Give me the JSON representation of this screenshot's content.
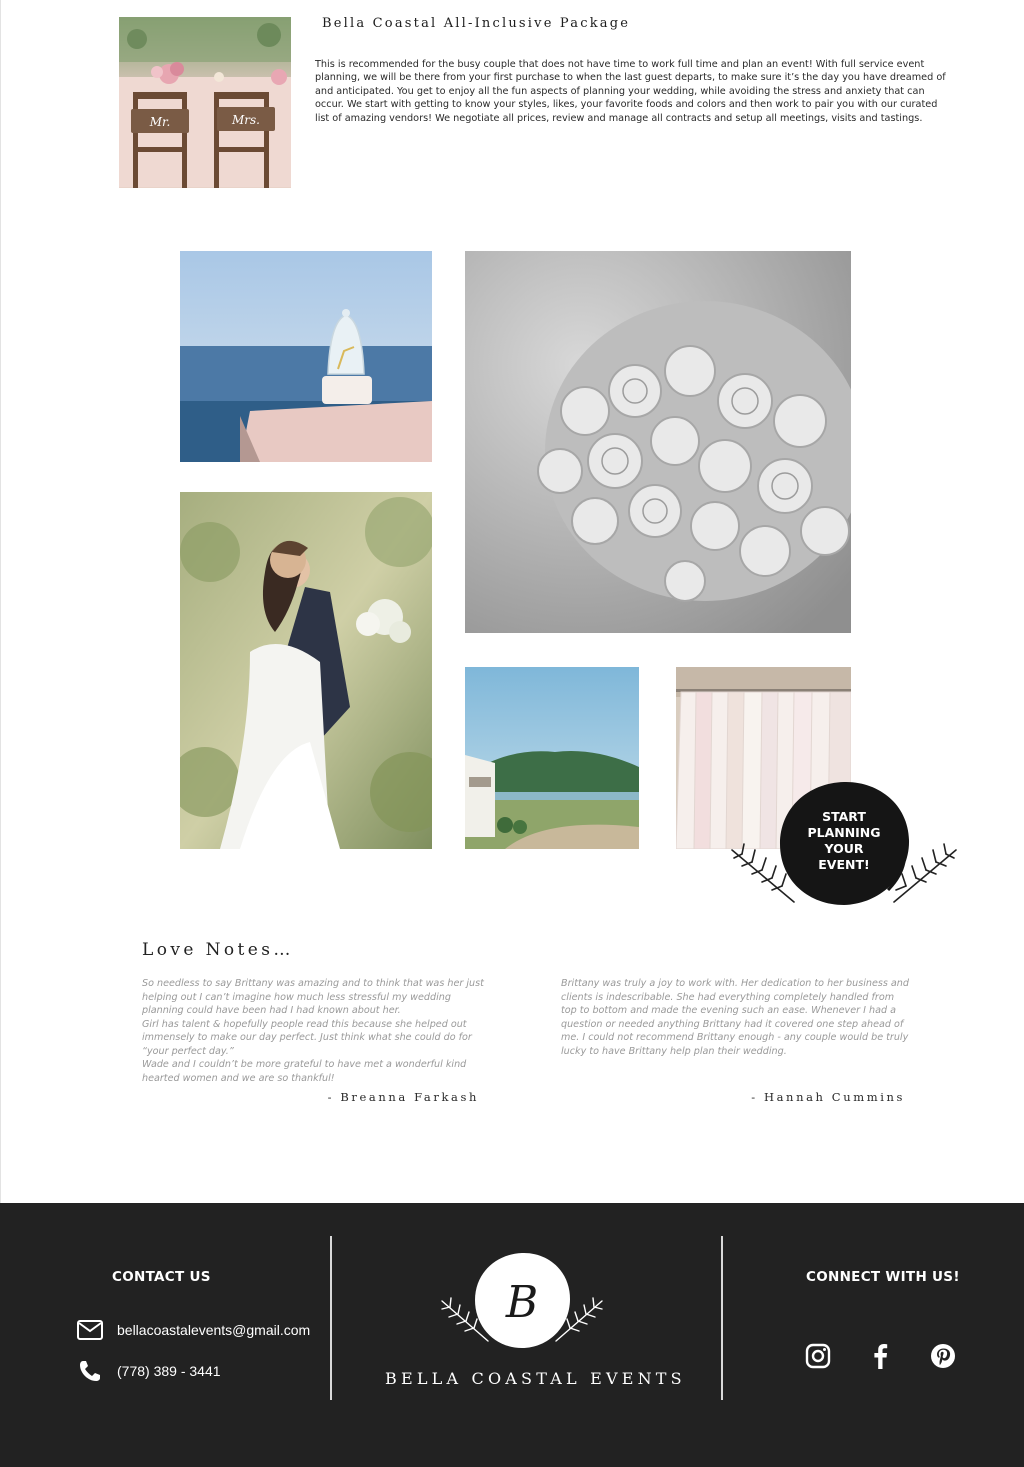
{
  "package": {
    "title": "Bella Coastal All-Inclusive Package",
    "description": "This is recommended for the busy couple that does not have time to work full time and plan an event! With full service event planning, we will be there from your first purchase to when the last guest departs, to make sure it’s the day you have dreamed of and anticipated. You get to enjoy all the fun aspects of planning your wedding, while avoiding the stress and anxiety that can occur. We start with getting to know your styles, likes, your favorite foods and colors and then work to pair you with our curated list of amazing vendors! We negotiate all prices, review and manage all contracts and setup all meetings, visits and tastings.",
    "photo_signs": [
      "Mr.",
      "Mrs."
    ]
  },
  "cta": {
    "line1": "START",
    "line2": "PLANNING",
    "line3": "YOUR",
    "line4": "EVENT!"
  },
  "love_notes": {
    "title": "Love Notes…",
    "testimonials": [
      {
        "text": "So needless to say Brittany was amazing and to think that was her just helping out I can’t imagine how much less stressful my wedding planning could have been had I had known about her.\nGirl has talent & hopefully people read this because she helped out immensely to make our day perfect. Just think what she could do for “your perfect day.”\nWade and I couldn’t be more grateful to have met a wonderful kind hearted women and we are so thankful!",
        "author": "- Breanna Farkash"
      },
      {
        "text": "Brittany was truly a joy to work with. Her dedication to her business and clients is indescribable. She had everything completely handled from top to bottom and made the evening such an ease. Whenever I had a question or needed anything Brittany had it covered one step ahead of me. I could not recommend Brittany enough - any couple would be truly lucky to have Brittany help plan their wedding.",
        "author": "- Hannah Cummins"
      }
    ]
  },
  "footer": {
    "contact_heading": "CONTACT US",
    "email": "bellacoastalevents@gmail.com",
    "phone": "(778) 389 - 3441",
    "logo_letter": "B",
    "brand_name": "BELLA COASTAL EVENTS",
    "connect_heading": "CONNECT WITH US!",
    "social_icons": [
      "instagram-icon",
      "facebook-icon",
      "pinterest-icon"
    ]
  },
  "colors": {
    "footer_bg": "#222222",
    "text_dark": "#222222",
    "testimonial_text": "#9a9a9a",
    "white": "#ffffff"
  }
}
